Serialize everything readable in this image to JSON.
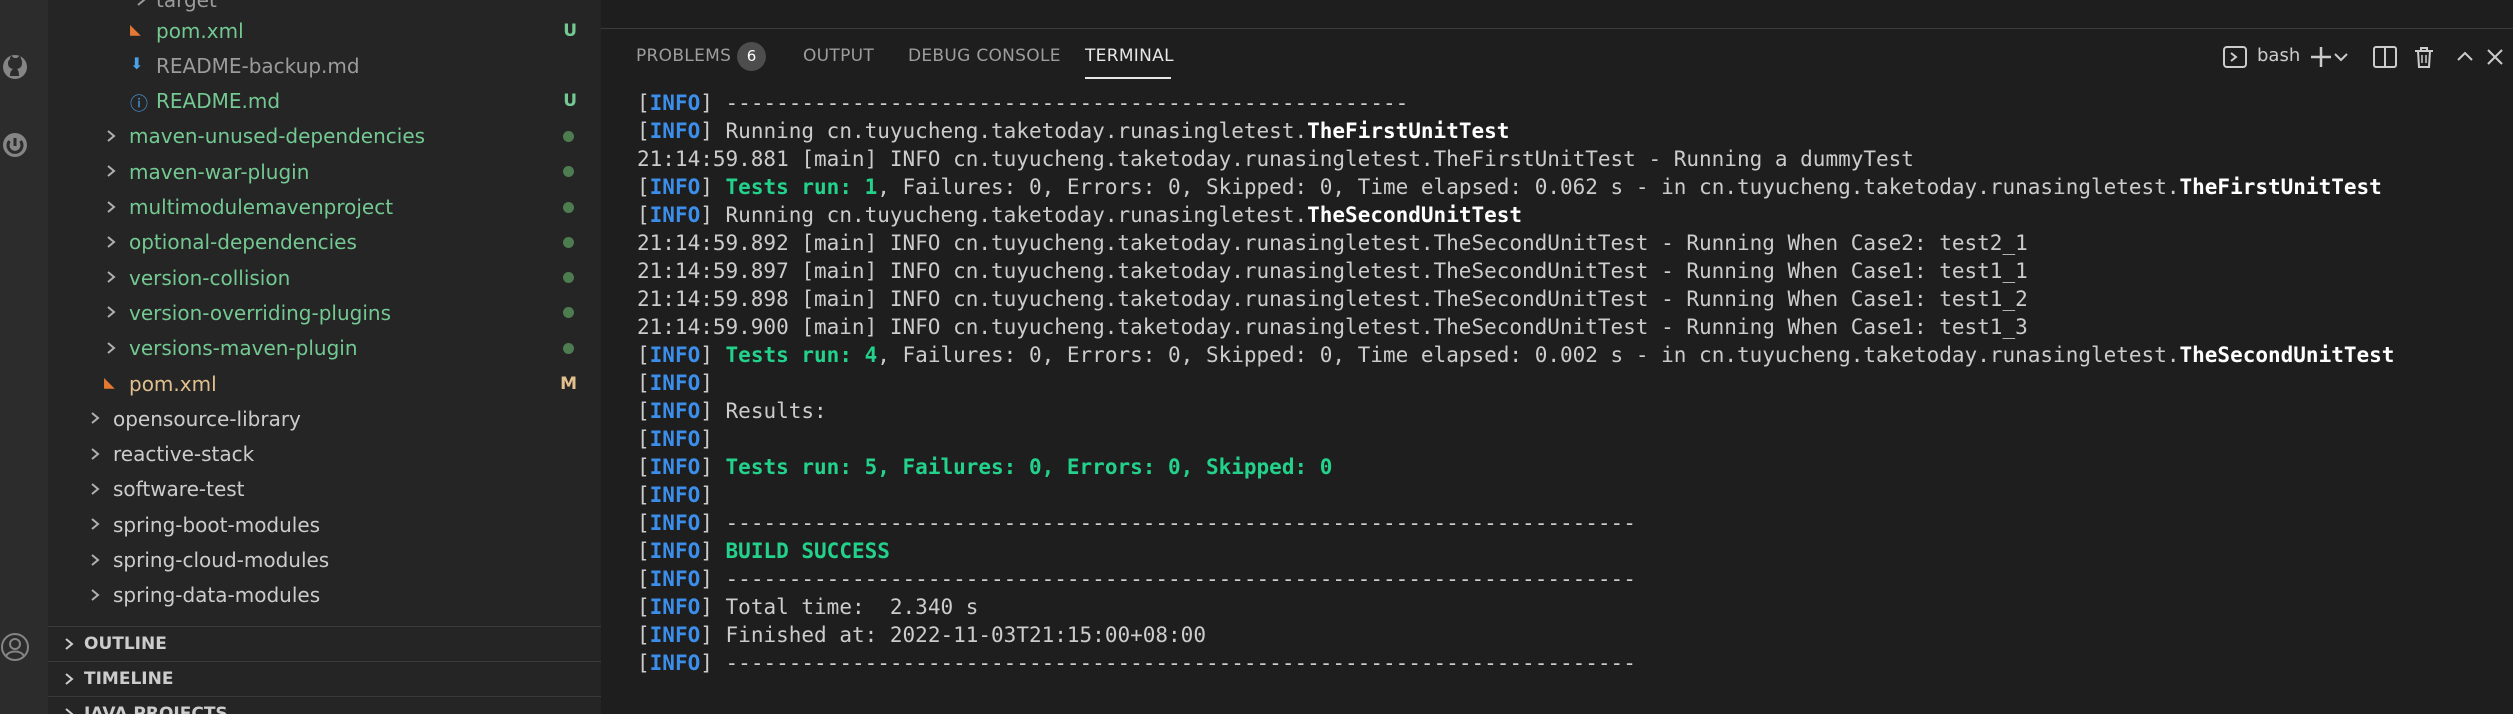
{
  "sidebar": {
    "partial_top": "target",
    "items": [
      {
        "label": "pom.xml",
        "status": "U",
        "color": "green",
        "icon": "rss-icon"
      },
      {
        "label": "README-backup.md",
        "status": "",
        "color": "dim",
        "icon": "download-arrow-icon"
      },
      {
        "label": "README.md",
        "status": "U",
        "color": "green",
        "icon": "info-icon"
      },
      {
        "label": "maven-unused-dependencies",
        "status": "dot",
        "color": "green"
      },
      {
        "label": "maven-war-plugin",
        "status": "dot",
        "color": "green"
      },
      {
        "label": "multimodulemavenproject",
        "status": "dot",
        "color": "green"
      },
      {
        "label": "optional-dependencies",
        "status": "dot",
        "color": "green"
      },
      {
        "label": "version-collision",
        "status": "dot",
        "color": "green"
      },
      {
        "label": "version-overriding-plugins",
        "status": "dot",
        "color": "green"
      },
      {
        "label": "versions-maven-plugin",
        "status": "dot",
        "color": "green"
      },
      {
        "label": "pom.xml",
        "status": "M",
        "color": "orange",
        "icon": "rss-icon"
      },
      {
        "label": "opensource-library",
        "status": "",
        "color": "plain"
      },
      {
        "label": "reactive-stack",
        "status": "",
        "color": "plain"
      },
      {
        "label": "software-test",
        "status": "",
        "color": "plain"
      },
      {
        "label": "spring-boot-modules",
        "status": "",
        "color": "plain"
      },
      {
        "label": "spring-cloud-modules",
        "status": "",
        "color": "plain"
      },
      {
        "label": "spring-data-modules",
        "status": "",
        "color": "plain"
      }
    ],
    "sections": [
      "OUTLINE",
      "TIMELINE",
      "JAVA PROJECTS"
    ]
  },
  "panel": {
    "tabs": [
      {
        "label": "PROBLEMS",
        "count": "6"
      },
      {
        "label": "OUTPUT"
      },
      {
        "label": "DEBUG CONSOLE"
      },
      {
        "label": "TERMINAL",
        "active": true
      }
    ],
    "terminal_name": "bash",
    "actions": [
      "terminal-icon",
      "plus-icon",
      "chevron-down-icon",
      "split-icon",
      "trash-icon",
      "chevron-up-icon",
      "close-icon"
    ]
  },
  "terminal": {
    "lines": [
      [
        [
          "br",
          "["
        ],
        [
          "info",
          "INFO"
        ],
        [
          "br",
          "] "
        ],
        [
          "plain",
          "------------------------------------------------------"
        ]
      ],
      [
        [
          "br",
          "["
        ],
        [
          "info",
          "INFO"
        ],
        [
          "br",
          "] "
        ],
        [
          "plain",
          "Running cn.tuyucheng.taketoday.runasingletest."
        ],
        [
          "b",
          "TheFirstUnitTest"
        ]
      ],
      [
        [
          "plain",
          "21:14:59.881 [main] INFO cn.tuyucheng.taketoday.runasingletest.TheFirstUnitTest - Running a dummyTest"
        ]
      ],
      [
        [
          "br",
          "["
        ],
        [
          "info",
          "INFO"
        ],
        [
          "br",
          "] "
        ],
        [
          "tg",
          "Tests run: 1"
        ],
        [
          "plain",
          ", Failures: 0, Errors: 0, Skipped: 0, Time elapsed: 0.062 s - in cn.tuyucheng.taketoday.runasingletest."
        ],
        [
          "b",
          "TheFirstUnitTest"
        ]
      ],
      [
        [
          "br",
          "["
        ],
        [
          "info",
          "INFO"
        ],
        [
          "br",
          "] "
        ],
        [
          "plain",
          "Running cn.tuyucheng.taketoday.runasingletest."
        ],
        [
          "b",
          "TheSecondUnitTest"
        ]
      ],
      [
        [
          "plain",
          "21:14:59.892 [main] INFO cn.tuyucheng.taketoday.runasingletest.TheSecondUnitTest - Running When Case2: test2_1"
        ]
      ],
      [
        [
          "plain",
          "21:14:59.897 [main] INFO cn.tuyucheng.taketoday.runasingletest.TheSecondUnitTest - Running When Case1: test1_1"
        ]
      ],
      [
        [
          "plain",
          "21:14:59.898 [main] INFO cn.tuyucheng.taketoday.runasingletest.TheSecondUnitTest - Running When Case1: test1_2"
        ]
      ],
      [
        [
          "plain",
          "21:14:59.900 [main] INFO cn.tuyucheng.taketoday.runasingletest.TheSecondUnitTest - Running When Case1: test1_3"
        ]
      ],
      [
        [
          "br",
          "["
        ],
        [
          "info",
          "INFO"
        ],
        [
          "br",
          "] "
        ],
        [
          "tg",
          "Tests run: 4"
        ],
        [
          "plain",
          ", Failures: 0, Errors: 0, Skipped: 0, Time elapsed: 0.002 s - in cn.tuyucheng.taketoday.runasingletest."
        ],
        [
          "b",
          "TheSecondUnitTest"
        ]
      ],
      [
        [
          "br",
          "["
        ],
        [
          "info",
          "INFO"
        ],
        [
          "br",
          "]"
        ]
      ],
      [
        [
          "br",
          "["
        ],
        [
          "info",
          "INFO"
        ],
        [
          "br",
          "] "
        ],
        [
          "plain",
          "Results:"
        ]
      ],
      [
        [
          "br",
          "["
        ],
        [
          "info",
          "INFO"
        ],
        [
          "br",
          "]"
        ]
      ],
      [
        [
          "br",
          "["
        ],
        [
          "info",
          "INFO"
        ],
        [
          "br",
          "] "
        ],
        [
          "tg",
          "Tests run: 5, Failures: 0, Errors: 0, Skipped: 0"
        ]
      ],
      [
        [
          "br",
          "["
        ],
        [
          "info",
          "INFO"
        ],
        [
          "br",
          "]"
        ]
      ],
      [
        [
          "br",
          "["
        ],
        [
          "info",
          "INFO"
        ],
        [
          "br",
          "] "
        ],
        [
          "plain",
          "------------------------------------------------------------------------"
        ]
      ],
      [
        [
          "br",
          "["
        ],
        [
          "info",
          "INFO"
        ],
        [
          "br",
          "] "
        ],
        [
          "tg",
          "BUILD SUCCESS"
        ]
      ],
      [
        [
          "br",
          "["
        ],
        [
          "info",
          "INFO"
        ],
        [
          "br",
          "] "
        ],
        [
          "plain",
          "------------------------------------------------------------------------"
        ]
      ],
      [
        [
          "br",
          "["
        ],
        [
          "info",
          "INFO"
        ],
        [
          "br",
          "] "
        ],
        [
          "plain",
          "Total time:  2.340 s"
        ]
      ],
      [
        [
          "br",
          "["
        ],
        [
          "info",
          "INFO"
        ],
        [
          "br",
          "] "
        ],
        [
          "plain",
          "Finished at: 2022-11-03T21:15:00+08:00"
        ]
      ],
      [
        [
          "br",
          "["
        ],
        [
          "info",
          "INFO"
        ],
        [
          "br",
          "] "
        ],
        [
          "plain",
          "------------------------------------------------------------------------"
        ]
      ]
    ]
  },
  "colors": {
    "info": "#3b8eea",
    "success": "#23d18b",
    "untracked": "#73c991",
    "modified": "#e2c08d"
  }
}
